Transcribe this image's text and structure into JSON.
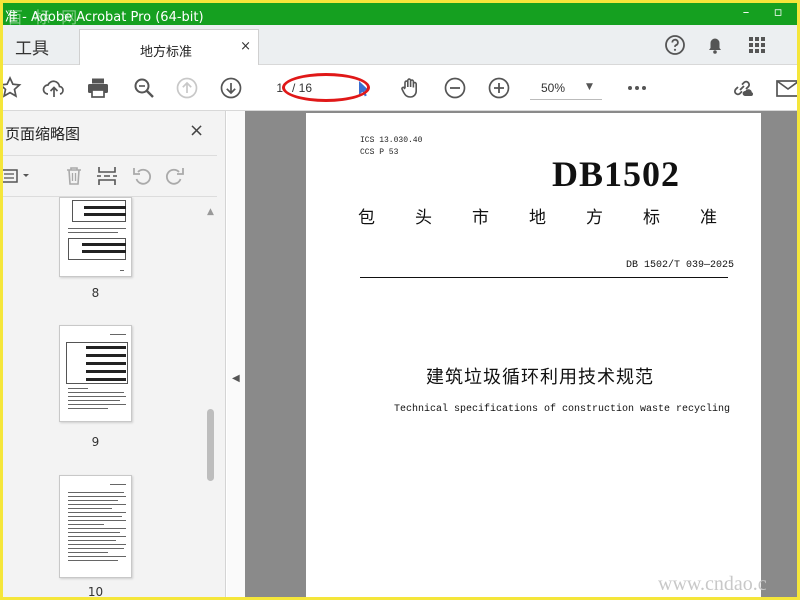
{
  "window": {
    "title": "准 - Adobe Acrobat Pro (64-bit)",
    "watermark": "百 标 网"
  },
  "tabs": {
    "tools_label": "工具",
    "document_tab_label": "地方标准",
    "close_glyph": "×"
  },
  "toolbar": {
    "current_page": "1",
    "page_total": "/ 16",
    "zoom": "50%"
  },
  "thumbnail_panel": {
    "title": "页面缩略图",
    "thumbnails": [
      {
        "page": "8"
      },
      {
        "page": "9"
      },
      {
        "page": "10"
      }
    ]
  },
  "document": {
    "ics": "ICS  13.030.40",
    "ccs": "CCS  P 53",
    "db_code": "DB1502",
    "city_line": "包头市地方标准",
    "standard_number": "DB 1502/T 039—2025",
    "title_cn": "建筑垃圾循环利用技术规范",
    "title_en": "Technical specifications of construction waste recycling"
  },
  "overlay_watermark": "www.cndao.c",
  "colors": {
    "titlebar": "#15a020",
    "outer_border": "#f5e63a",
    "annotation": "#e01818",
    "doc_background": "#8a8a8a"
  }
}
